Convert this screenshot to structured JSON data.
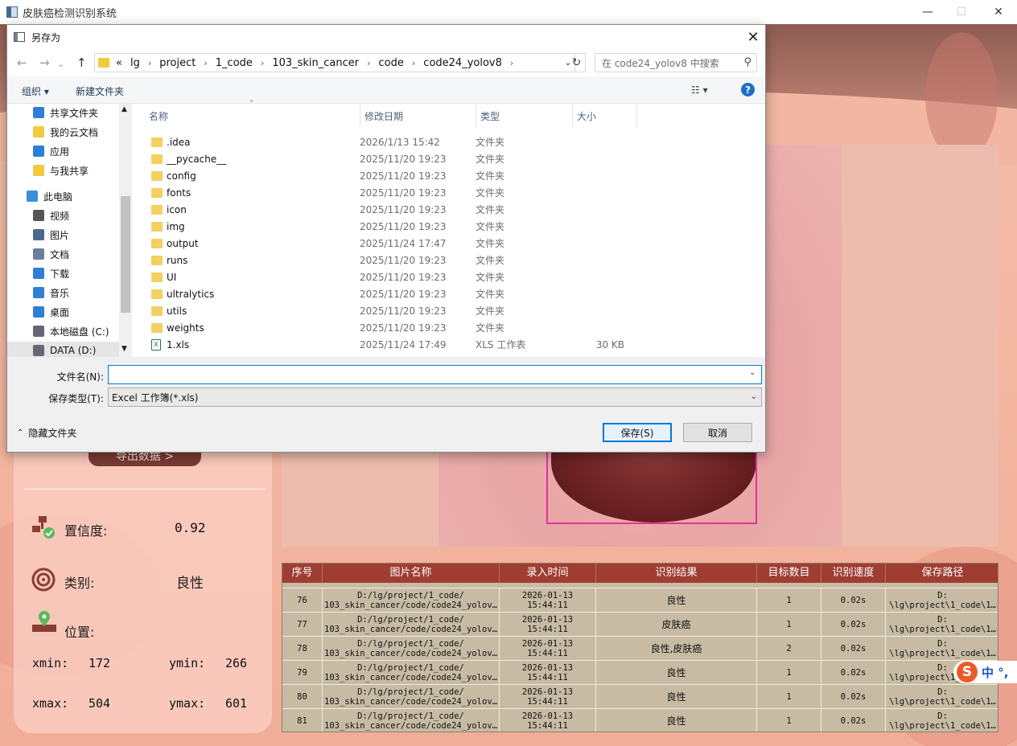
{
  "app": {
    "title": "皮肤癌检测识别系统",
    "window_controls": [
      "—",
      "☐",
      "✕"
    ],
    "export_button": "导出数据 >",
    "info": {
      "confidence_label": "置信度:",
      "confidence_value": "0.92",
      "class_label": "类别:",
      "class_value": "良性",
      "position_label": "位置:",
      "xmin_label": "xmin:",
      "xmin_value": "172",
      "ymin_label": "ymin:",
      "ymin_value": "266",
      "xmax_label": "xmax:",
      "xmax_value": "504",
      "ymax_label": "ymax:",
      "ymax_value": "601"
    },
    "table": {
      "headers": [
        "序号",
        "图片名称",
        "录入时间",
        "识别结果",
        "目标数目",
        "识别速度",
        "保存路径"
      ],
      "rows": [
        {
          "id": "76",
          "name_1": "D:/lg/project/1_code/",
          "name_2": "103_skin_cancer/code/code24_yolov…",
          "date": "2026-01-13",
          "time": "15:44:11",
          "result": "良性",
          "count": "1",
          "speed": "0.02s",
          "path_1": "D:",
          "path_2": "\\lg\\project\\1_code\\1…"
        },
        {
          "id": "77",
          "name_1": "D:/lg/project/1_code/",
          "name_2": "103_skin_cancer/code/code24_yolov…",
          "date": "2026-01-13",
          "time": "15:44:11",
          "result": "皮肤癌",
          "count": "1",
          "speed": "0.02s",
          "path_1": "D:",
          "path_2": "\\lg\\project\\1_code\\1…"
        },
        {
          "id": "78",
          "name_1": "D:/lg/project/1_code/",
          "name_2": "103_skin_cancer/code/code24_yolov…",
          "date": "2026-01-13",
          "time": "15:44:11",
          "result": "良性,皮肤癌",
          "count": "2",
          "speed": "0.02s",
          "path_1": "D:",
          "path_2": "\\lg\\project\\1_code\\1…"
        },
        {
          "id": "79",
          "name_1": "D:/lg/project/1_code/",
          "name_2": "103_skin_cancer/code/code24_yolov…",
          "date": "2026-01-13",
          "time": "15:44:11",
          "result": "良性",
          "count": "1",
          "speed": "0.02s",
          "path_1": "D:",
          "path_2": "\\lg\\project\\1_code\\1…"
        },
        {
          "id": "80",
          "name_1": "D:/lg/project/1_code/",
          "name_2": "103_skin_cancer/code/code24_yolov…",
          "date": "2026-01-13",
          "time": "15:44:11",
          "result": "良性",
          "count": "1",
          "speed": "0.02s",
          "path_1": "D:",
          "path_2": "\\lg\\project\\1_code\\1…"
        },
        {
          "id": "81",
          "name_1": "D:/lg/project/1_code/",
          "name_2": "103_skin_cancer/code/code24_yolov…",
          "date": "2026-01-13",
          "time": "15:44:11",
          "result": "良性",
          "count": "1",
          "speed": "0.02s",
          "path_1": "D:",
          "path_2": "\\lg\\project\\1_code\\1…"
        }
      ]
    },
    "ime": {
      "logo": "S",
      "text": "中 °,"
    }
  },
  "dialog": {
    "title": "另存为",
    "close": "✕",
    "nav": {
      "back": "←",
      "forward": "→",
      "up": "↑",
      "recent": "⌄"
    },
    "address": [
      "«",
      "lg",
      "project",
      "1_code",
      "103_skin_cancer",
      "code",
      "code24_yolov8"
    ],
    "address_sep": "›",
    "refresh": "↻",
    "search_placeholder": "在 code24_yolov8 中搜索",
    "toolbar": {
      "organize": "组织 ▾",
      "new_folder": "新建文件夹",
      "view": "☷ ▾",
      "help": "?"
    },
    "sidebar": [
      {
        "label": "共享文件夹",
        "icon": "shared-folder-icon"
      },
      {
        "label": "我的云文档",
        "icon": "cloud-doc-icon"
      },
      {
        "label": "应用",
        "icon": "apps-icon"
      },
      {
        "label": "与我共享",
        "icon": "shared-with-me-icon"
      },
      {
        "label": "此电脑",
        "icon": "computer-icon"
      },
      {
        "label": "视频",
        "icon": "video-icon"
      },
      {
        "label": "图片",
        "icon": "pictures-icon"
      },
      {
        "label": "文档",
        "icon": "documents-icon"
      },
      {
        "label": "下载",
        "icon": "download-icon"
      },
      {
        "label": "音乐",
        "icon": "music-icon"
      },
      {
        "label": "桌面",
        "icon": "desktop-icon"
      },
      {
        "label": "本地磁盘 (C:)",
        "icon": "drive-icon"
      },
      {
        "label": "DATA (D:)",
        "icon": "drive-icon"
      }
    ],
    "columns": {
      "name": "名称",
      "date": "修改日期",
      "type": "类型",
      "size": "大小"
    },
    "files": [
      {
        "name": ".idea",
        "date": "2026/1/13 15:42",
        "type": "文件夹",
        "size": ""
      },
      {
        "name": "__pycache__",
        "date": "2025/11/20 19:23",
        "type": "文件夹",
        "size": ""
      },
      {
        "name": "config",
        "date": "2025/11/20 19:23",
        "type": "文件夹",
        "size": ""
      },
      {
        "name": "fonts",
        "date": "2025/11/20 19:23",
        "type": "文件夹",
        "size": ""
      },
      {
        "name": "icon",
        "date": "2025/11/20 19:23",
        "type": "文件夹",
        "size": ""
      },
      {
        "name": "img",
        "date": "2025/11/20 19:23",
        "type": "文件夹",
        "size": ""
      },
      {
        "name": "output",
        "date": "2025/11/24 17:47",
        "type": "文件夹",
        "size": ""
      },
      {
        "name": "runs",
        "date": "2025/11/20 19:23",
        "type": "文件夹",
        "size": ""
      },
      {
        "name": "UI",
        "date": "2025/11/20 19:23",
        "type": "文件夹",
        "size": ""
      },
      {
        "name": "ultralytics",
        "date": "2025/11/20 19:23",
        "type": "文件夹",
        "size": ""
      },
      {
        "name": "utils",
        "date": "2025/11/20 19:23",
        "type": "文件夹",
        "size": ""
      },
      {
        "name": "weights",
        "date": "2025/11/20 19:23",
        "type": "文件夹",
        "size": ""
      },
      {
        "name": "1.xls",
        "date": "2025/11/24 17:49",
        "type": "XLS 工作表",
        "size": "30 KB"
      }
    ],
    "filename_label": "文件名(N):",
    "filename_value": "",
    "filetype_label": "保存类型(T):",
    "filetype_value": "Excel 工作簿(*.xls)",
    "hide_folders": "隐藏文件夹",
    "save_button": "保存(S)",
    "cancel_button": "取消"
  }
}
